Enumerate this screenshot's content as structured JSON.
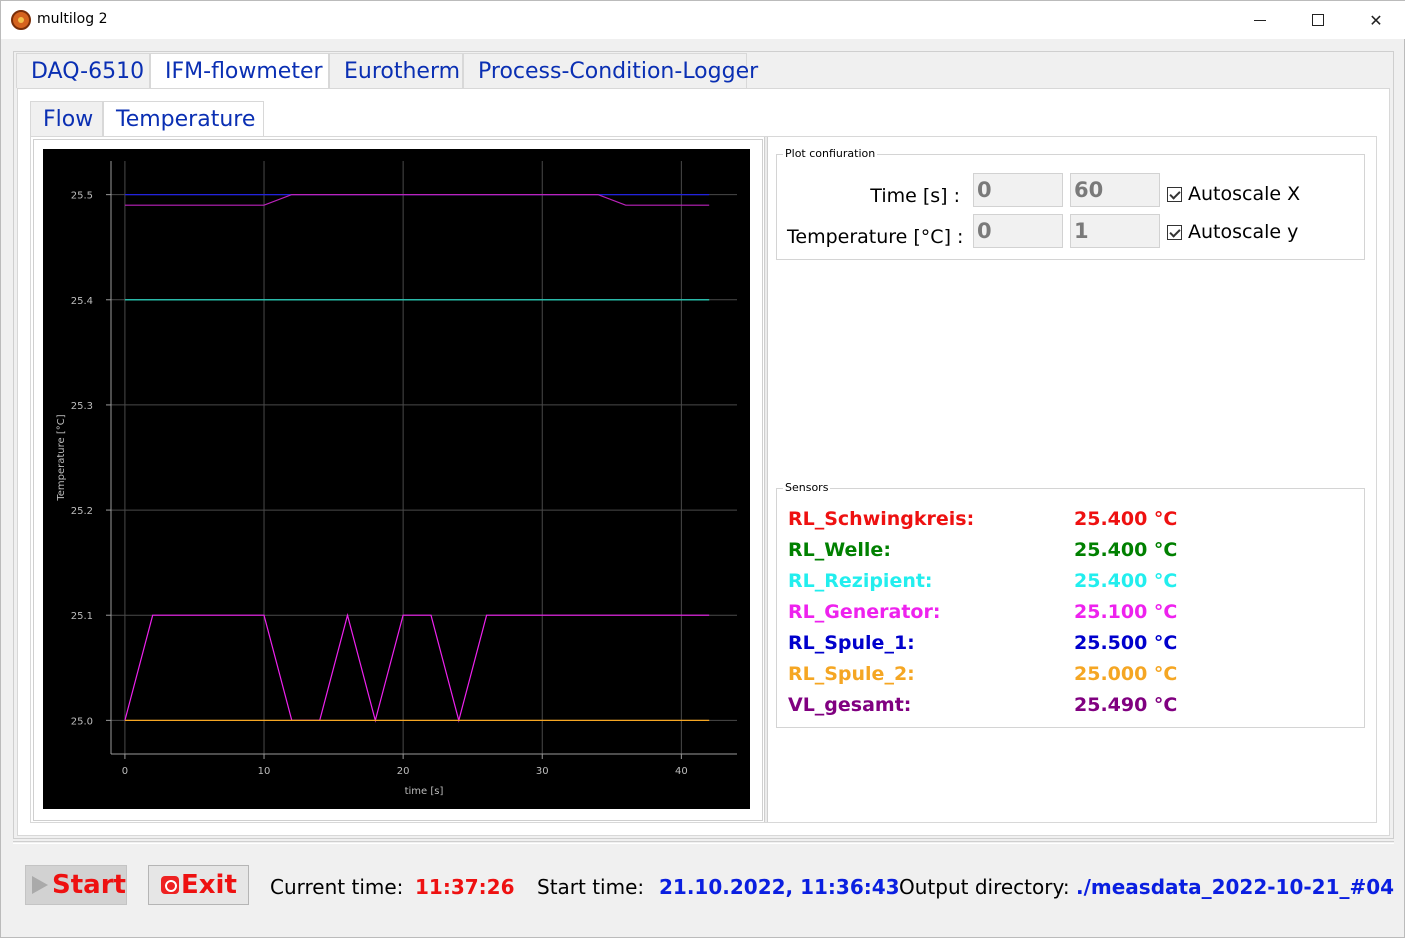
{
  "window": {
    "title": "multilog 2"
  },
  "tabs": [
    {
      "label": "DAQ-6510"
    },
    {
      "label": "IFM-flowmeter"
    },
    {
      "label": "Eurotherm"
    },
    {
      "label": "Process-Condition-Logger"
    }
  ],
  "active_tab": "IFM-flowmeter",
  "subtabs": [
    {
      "label": "Flow"
    },
    {
      "label": "Temperature"
    }
  ],
  "active_subtab": "Temperature",
  "plot_config": {
    "title": "Plot confiuration",
    "time_label": "Time [s] :",
    "time_min": "0",
    "time_max": "60",
    "autoscale_x_label": "Autoscale X",
    "autoscale_x": true,
    "temp_label": "Temperature [°C] :",
    "temp_min": "0",
    "temp_max": "1",
    "autoscale_y_label": "Autoscale y",
    "autoscale_y": true
  },
  "sensors": {
    "title": "Sensors",
    "items": [
      {
        "name": "RL_Schwingkreis:",
        "value": "25.400 °C",
        "color": "#ee1111"
      },
      {
        "name": "RL_Welle:",
        "value": "25.400 °C",
        "color": "#008000"
      },
      {
        "name": "RL_Rezipient:",
        "value": "25.400 °C",
        "color": "#22eeee"
      },
      {
        "name": "RL_Generator:",
        "value": "25.100 °C",
        "color": "#ee22ee"
      },
      {
        "name": "RL_Spule_1:",
        "value": "25.500 °C",
        "color": "#0000cc"
      },
      {
        "name": "RL_Spule_2:",
        "value": "25.000 °C",
        "color": "#f5a623"
      },
      {
        "name": "VL_gesamt:",
        "value": "25.490 °C",
        "color": "#800080"
      }
    ]
  },
  "status": {
    "start_label": "Start",
    "exit_label": "Exit",
    "current_time_label": "Current time:",
    "current_time": "11:37:26",
    "start_time_label": "Start time:",
    "start_time": "21.10.2022, 11:36:43",
    "output_dir_label": "Output directory:",
    "output_dir": "./measdata_2022-10-21_#04",
    "colors": {
      "current_time": "#ee1111",
      "start_time": "#0a1fe0",
      "output_dir": "#0a1fe0"
    }
  },
  "chart_data": {
    "type": "line",
    "xlabel": "time [s]",
    "ylabel": "Temperature [°C]",
    "xlim": [
      -1,
      44
    ],
    "ylim": [
      24.968,
      25.532
    ],
    "xticks": [
      0,
      10,
      20,
      30,
      40
    ],
    "yticks": [
      25.0,
      25.1,
      25.2,
      25.3,
      25.4,
      25.5
    ],
    "grid": true,
    "background": "#000000",
    "series": [
      {
        "color": "#ee1111",
        "x": [
          0,
          42
        ],
        "y": [
          25.4,
          25.4
        ]
      },
      {
        "color": "#008000",
        "x": [
          0,
          42
        ],
        "y": [
          25.4,
          25.4
        ]
      },
      {
        "color": "#22dddd",
        "x": [
          0,
          42
        ],
        "y": [
          25.4,
          25.4
        ]
      },
      {
        "color": "#ee22ee",
        "x": [
          0,
          2,
          10,
          12,
          14,
          16,
          18,
          20,
          22,
          24,
          26,
          42
        ],
        "y": [
          25.0,
          25.1,
          25.1,
          25.0,
          25.0,
          25.1,
          25.0,
          25.1,
          25.1,
          25.0,
          25.1,
          25.1
        ]
      },
      {
        "color": "#2222dd",
        "x": [
          0,
          42
        ],
        "y": [
          25.5,
          25.5
        ]
      },
      {
        "color": "#f5a623",
        "x": [
          0,
          42
        ],
        "y": [
          25.0,
          25.0
        ]
      },
      {
        "color": "#bb22bb",
        "x": [
          0,
          10,
          12,
          34,
          36,
          42
        ],
        "y": [
          25.49,
          25.49,
          25.5,
          25.5,
          25.49,
          25.49
        ]
      }
    ]
  }
}
